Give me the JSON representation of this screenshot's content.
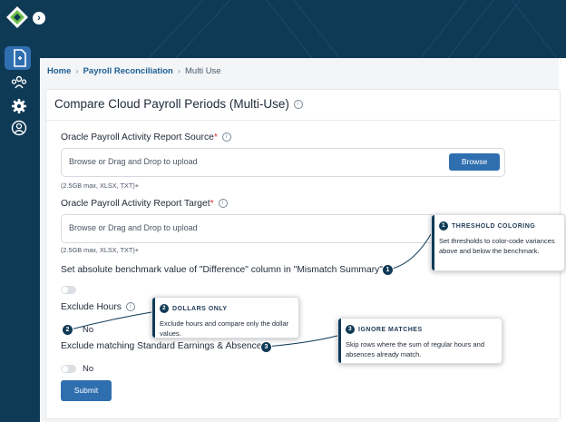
{
  "breadcrumb": {
    "home": "Home",
    "section": "Payroll Reconciliation",
    "current": "Multi Use"
  },
  "page_title": "Compare Cloud Payroll Periods (Multi-Use)",
  "source": {
    "label": "Oracle Payroll Activity Report Source",
    "required_mark": "*",
    "placeholder": "Browse or Drag and Drop to upload",
    "browse_label": "Browse",
    "hint": "(2.5GB max, XLSX, TXT)+"
  },
  "target": {
    "label": "Oracle Payroll Activity Report Target",
    "required_mark": "*",
    "placeholder": "Browse or Drag and Drop to upload",
    "hint": "(2.5GB max, XLSX, TXT)+"
  },
  "benchmark": {
    "label": "Set absolute benchmark value of \"Difference\" column in \"Mismatch Summary\""
  },
  "exclude_hours": {
    "label": "Exclude Hours",
    "toggle_text": "No"
  },
  "exclude_matching": {
    "label": "Exclude matching Standard Earnings & Absences",
    "toggle_text": "No"
  },
  "submit_label": "Submit",
  "callouts": [
    {
      "number": "1",
      "title": "THRESHOLD COLORING",
      "body": "Set thresholds to color-code variances above and below the benchmark."
    },
    {
      "number": "2",
      "title": "DOLLARS ONLY",
      "body": "Exclude hours and compare only the dollar values."
    },
    {
      "number": "3",
      "title": "IGNORE MATCHES",
      "body": "Skip rows where the sum of regular hours and absences already match."
    }
  ],
  "colors": {
    "sidebar": "#0f3a56",
    "accent": "#2f6fb0",
    "required": "#d9302f"
  },
  "icons": {
    "logo": "app-logo-icon",
    "expand": "chevron-right-icon",
    "nav": [
      "document-icon",
      "users-icon",
      "gear-icon",
      "user-circle-icon"
    ],
    "info": "info-icon"
  }
}
